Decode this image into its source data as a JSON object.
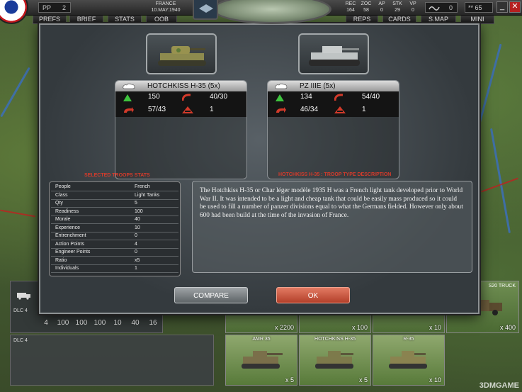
{
  "topbar": {
    "pp_label": "PP",
    "pp_value": "2",
    "country": "FRANCE",
    "date": "10.MAY.1940",
    "stat_headers": [
      "REC",
      "ZOC",
      "AP",
      "STK",
      "VP"
    ],
    "stat_values": [
      "164",
      "58",
      "0",
      "29",
      "0"
    ],
    "box2_value": "0",
    "stars_value": "** 65"
  },
  "menu": {
    "tabs": [
      "PREFS",
      "BRIEF",
      "STATS",
      "OOB",
      "REPS",
      "CARDS",
      "S.MAP",
      "MINI"
    ]
  },
  "dialog": {
    "left_unit": {
      "name": "HOTCHKISS H-35 (5x)",
      "soft_attack": "150",
      "hard_attack": "40/30",
      "defense": "57/43",
      "range": "1"
    },
    "right_unit": {
      "name": "PZ IIIE (5x)",
      "soft_attack": "134",
      "hard_attack": "54/40",
      "defense": "46/34",
      "range": "1"
    },
    "stats_title": "SELECTED TROOPS STATS",
    "desc_title": "HOTCHKISS H-35 : TROOP TYPE DESCRIPTION",
    "stats_rows": [
      {
        "k": "People",
        "v": "French"
      },
      {
        "k": "Class",
        "v": "Light Tanks"
      },
      {
        "k": "Qty",
        "v": "5"
      },
      {
        "k": "Readiness",
        "v": "100"
      },
      {
        "k": "Morale",
        "v": "40"
      },
      {
        "k": "Experience",
        "v": "10"
      },
      {
        "k": "Entrenchment",
        "v": "0"
      },
      {
        "k": "Action Points",
        "v": "4"
      },
      {
        "k": "Engineer Points",
        "v": "0"
      },
      {
        "k": "Ratio",
        "v": "x5"
      },
      {
        "k": "Individuals",
        "v": "1"
      }
    ],
    "description": "The Hotchkiss H-35 or Char léger modèle 1935 H was a French light tank developed prior to World War II. It was intended to be a light and cheap tank that could be easily mass produced so it could be used to fill a number of panzer divisions equal to what the Germans fielded. However only about 600 had been build at the time of the invasion of France.",
    "compare_label": "COMPARE",
    "ok_label": "OK"
  },
  "bottom": {
    "dlc_label": "DLC 4",
    "numbers": [
      "4",
      "100",
      "100",
      "100",
      "10",
      "40",
      "16"
    ],
    "top_counts": [
      "x 2200",
      "x 100",
      "x 10",
      "x 400"
    ],
    "s20_label": "S20 TRUCK",
    "cards": [
      {
        "name": "AMR 35",
        "count": "x 5"
      },
      {
        "name": "HOTCHKISS H-35",
        "count": "x 5"
      },
      {
        "name": "R-35",
        "count": "x 10"
      }
    ],
    "watermark": "3DMGAME"
  }
}
